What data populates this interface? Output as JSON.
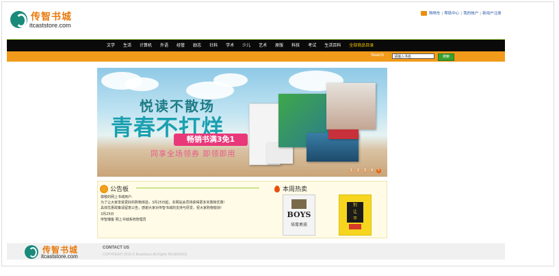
{
  "header": {
    "logo_cn": "传智书城",
    "logo_en": "itcaststore.com",
    "top_links": [
      "购物车",
      "帮助中心",
      "我的帐户",
      "新用户注册"
    ]
  },
  "nav": {
    "items": [
      "文学",
      "生活",
      "计算机",
      "外语",
      "经管",
      "励志",
      "社科",
      "学术",
      "少儿",
      "艺术",
      "原版",
      "科技",
      "考试",
      "生活百科"
    ],
    "highlight": "全部商品目录"
  },
  "search": {
    "label": "Search",
    "placeholder": "请输入书名",
    "button": "搜索"
  },
  "banner": {
    "title1": "悦读不散场",
    "title2": "青春不打烊",
    "promo": "畅销书满3免1",
    "sub": "同享全场领券 即领即用",
    "dots": [
      "1",
      "2",
      "3",
      "4",
      "5"
    ]
  },
  "notice": {
    "title": "公告板",
    "lines": [
      "尊敬的网上书城用户:",
      "    为了让大家享受更好的购物体验，3月25日起，本网站会员将获得更多实惠和优惠!",
      "具体优惠政策请留意公告，感谢大家对传智书城的支持与厚爱，祝大家购物愉快!",
      "3月25日",
      "传智播客 网上书城系统管理员"
    ]
  },
  "hot": {
    "title": "本周热卖",
    "book1_title": "BOYS",
    "book1_sub": "培育男孩",
    "book2_lines": [
      "别",
      "让",
      "不",
      "靠谱"
    ]
  },
  "footer": {
    "contact": "CONTACT US",
    "copyright": "COPYRIGHT 2015 © BookStore All Rights RESERVED."
  },
  "colors": {
    "nav_bg": "#0a0a0a",
    "search_bg": "#f29a1a",
    "accent_green": "#9fcf3f",
    "logo_teal": "#1a8a7a",
    "logo_orange": "#e87a0e"
  }
}
